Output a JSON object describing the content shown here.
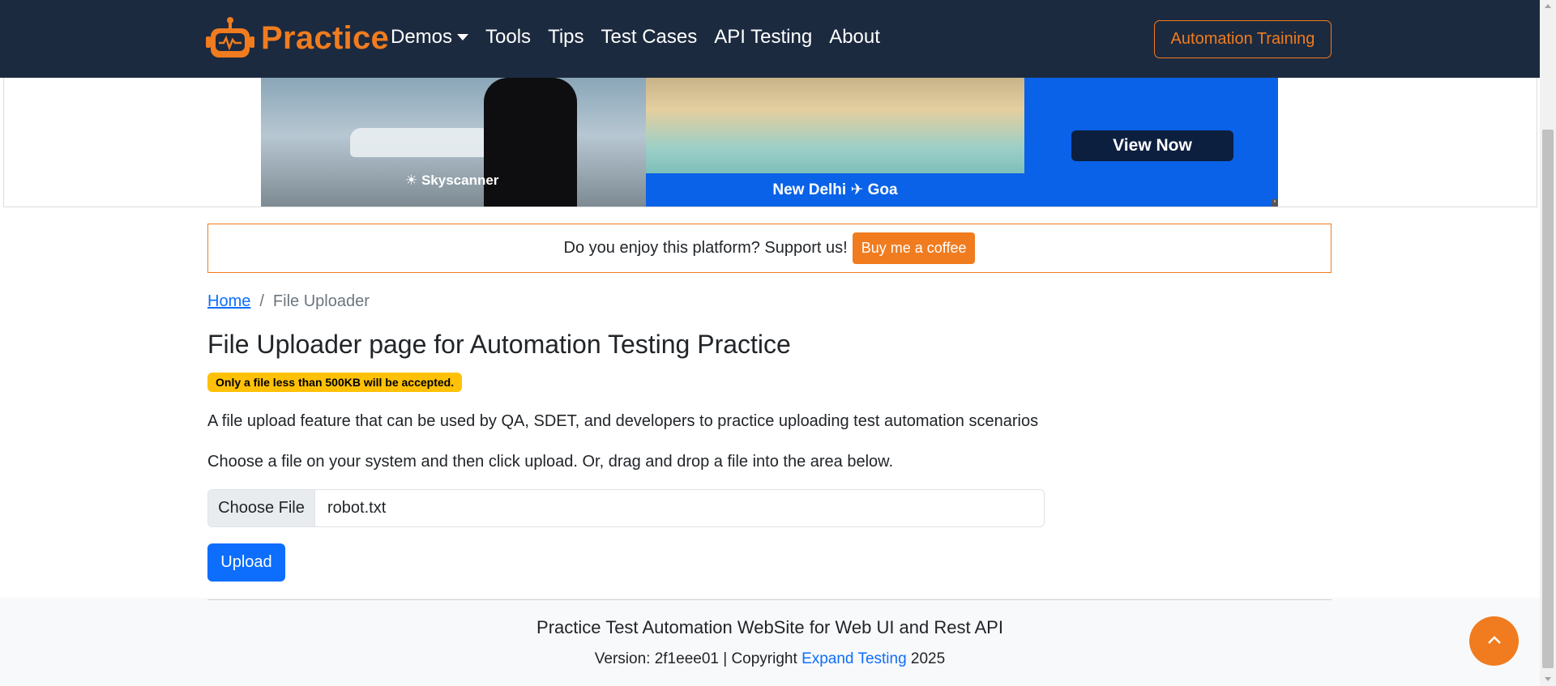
{
  "navbar": {
    "brand": "Practice",
    "items": [
      {
        "label": "Demos"
      },
      {
        "label": "Tools"
      },
      {
        "label": "Tips"
      },
      {
        "label": "Test Cases"
      },
      {
        "label": "API Testing"
      },
      {
        "label": "About"
      }
    ],
    "training_button": "Automation Training"
  },
  "ad": {
    "brand": "Skyscanner",
    "route": "New Delhi ✈ Goa",
    "cta": "View Now"
  },
  "support": {
    "text": "Do you enjoy this platform? Support us!",
    "button": "Buy me a coffee"
  },
  "breadcrumb": {
    "home": "Home",
    "separator": "/",
    "current": "File Uploader"
  },
  "page": {
    "title": "File Uploader page for Automation Testing Practice",
    "badge": "Only a file less than 500KB will be accepted.",
    "description": "A file upload feature that can be used by QA, SDET, and developers to practice uploading test automation scenarios",
    "instructions": "Choose a file on your system and then click upload. Or, drag and drop a file into the area below.",
    "file_button": "Choose File",
    "file_name": "robot.txt",
    "upload_button": "Upload"
  },
  "footer": {
    "title": "Practice Test Automation WebSite for Web UI and Rest API",
    "version_prefix": "Version: 2f1eee01 | Copyright",
    "company": "Expand Testing",
    "year": "2025"
  },
  "colors": {
    "navbar_bg": "#1c2a3f",
    "accent": "#f07c1f",
    "primary": "#0d6efd",
    "warning": "#ffc107"
  },
  "icons": {
    "logo": "robot-icon",
    "back_to_top": "chevron-up-icon"
  }
}
